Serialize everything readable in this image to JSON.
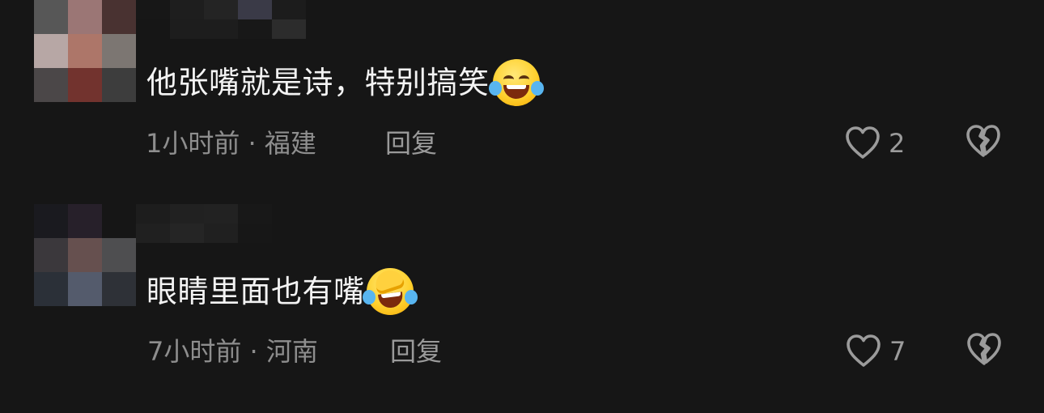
{
  "comments": [
    {
      "text": "他张嘴就是诗，特别搞笑",
      "emoji": "face-with-tears-of-joy-icon",
      "time_location": "1小时前 · 福建",
      "reply_label": "回复",
      "like_count": "2"
    },
    {
      "text": "眼睛里面也有嘴",
      "emoji": "facepalm-laughing-crying-icon",
      "time_location": "7小时前 · 河南",
      "reply_label": "回复",
      "like_count": "7"
    }
  ],
  "colors": {
    "background": "#161616",
    "primary_text": "#f3f3f3",
    "secondary_text": "#8e8e8e",
    "icon": "#9b9b9b"
  },
  "icons": {
    "like": "heart-outline-icon",
    "dislike": "broken-heart-outline-icon"
  }
}
